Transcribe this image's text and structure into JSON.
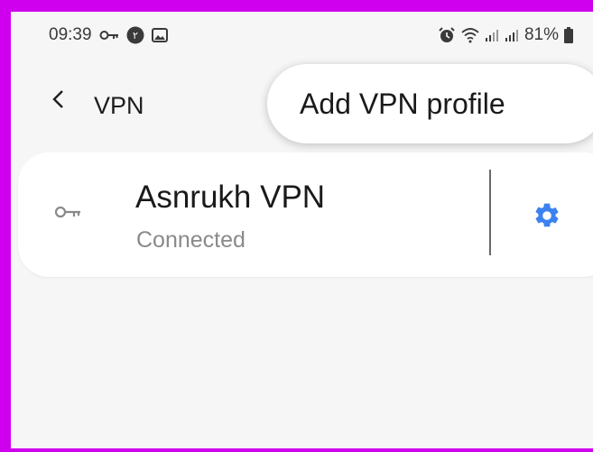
{
  "status_bar": {
    "time": "09:39",
    "battery": "81%",
    "icons": [
      "key-icon",
      "notification-badge-icon",
      "image-icon",
      "alarm-icon",
      "wifi-icon",
      "signal-icon",
      "signal-icon",
      "battery-icon"
    ]
  },
  "header": {
    "title": "VPN",
    "back_icon": "chevron-left-icon",
    "more_icon": "more-vertical-icon"
  },
  "menu": {
    "items": [
      {
        "label": "Add VPN profile"
      }
    ]
  },
  "vpn_list": {
    "items": [
      {
        "name": "Asnrukh VPN",
        "status": "Connected",
        "icon": "key-icon",
        "settings_icon": "gear-icon"
      }
    ]
  },
  "colors": {
    "frame": "#cf00ee",
    "background": "#f6f6f6",
    "card": "#ffffff",
    "accent": "#3c82f0",
    "secondary_text": "#8a8a8a"
  }
}
